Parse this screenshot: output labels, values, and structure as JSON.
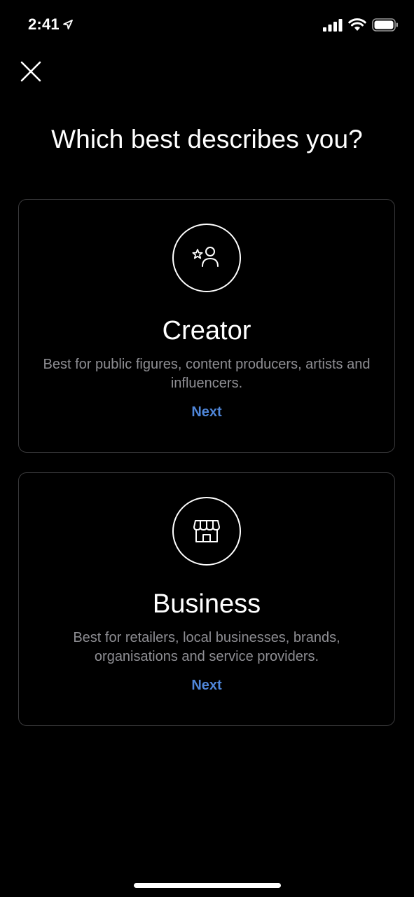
{
  "status_bar": {
    "time": "2:41",
    "location_icon": "location-arrow-icon",
    "signal_icon": "cellular-signal-icon",
    "wifi_icon": "wifi-icon",
    "battery_icon": "battery-icon"
  },
  "header": {
    "close_icon": "close-icon",
    "title": "Which best describes you?"
  },
  "options": [
    {
      "icon": "creator-person-star-icon",
      "title": "Creator",
      "description": "Best for public figures, content producers, artists and influencers.",
      "next_label": "Next"
    },
    {
      "icon": "storefront-icon",
      "title": "Business",
      "description": "Best for retailers, local businesses, brands, organisations and service providers.",
      "next_label": "Next"
    }
  ],
  "colors": {
    "background": "#000000",
    "text_primary": "#ffffff",
    "text_secondary": "#8e8e93",
    "accent": "#4f86d9",
    "card_border": "#3a3a3c"
  }
}
